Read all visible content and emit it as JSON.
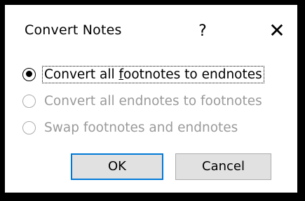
{
  "dialog": {
    "title": "Convert Notes",
    "help_label": "?",
    "close_icon": "close-icon",
    "close_glyph": "✕"
  },
  "options": [
    {
      "label_pre": "Convert all ",
      "label_access": "f",
      "label_post": "ootnotes to endnotes",
      "selected": true,
      "enabled": true
    },
    {
      "label": "Convert all endnotes to footnotes",
      "selected": false,
      "enabled": false
    },
    {
      "label": "Swap footnotes and endnotes",
      "selected": false,
      "enabled": false
    }
  ],
  "buttons": {
    "ok_label": "OK",
    "cancel_label": "Cancel"
  },
  "colors": {
    "border": "#000000",
    "default_button_border": "#0078d7",
    "button_bg": "#e1e1e1",
    "disabled_text": "#9a9a9a"
  }
}
